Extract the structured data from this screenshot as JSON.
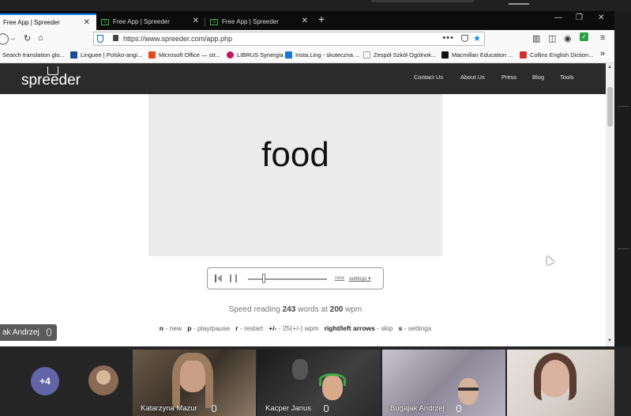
{
  "browser": {
    "tabs": [
      {
        "label": "Free App | Spreeder",
        "active": true
      },
      {
        "label": "Free App | Spreeder",
        "active": false
      },
      {
        "label": "Free App | Spreeder",
        "active": false
      }
    ],
    "new_tab": "+",
    "window_controls": {
      "minimize": "—",
      "restore": "❐",
      "close": "✕"
    },
    "url": "https://www.spreeder.com/app.php",
    "url_menu": "•••",
    "bookmarks": [
      {
        "label": "Search translation glo...",
        "color": "#8a8a8a"
      },
      {
        "label": "Linguee | Polsko-angi...",
        "color": "#1b4c8c"
      },
      {
        "label": "Microsoft Office — str...",
        "color": "#e64a19"
      },
      {
        "label": "LIBRUS Synergia",
        "color": "#c2185b"
      },
      {
        "label": "Insta.Ling - skuteczna ...",
        "color": "#1976d2"
      },
      {
        "label": "Zespół Szkół Ogólnok...",
        "color": "#9e9e9e"
      },
      {
        "label": "Macmillan Education ...",
        "color": "#111111"
      },
      {
        "label": "Collins English Diction...",
        "color": "#d32f2f"
      }
    ],
    "bookmarks_overflow": "»"
  },
  "site": {
    "logo": "spreeder",
    "nav": [
      "Contact Us",
      "About Us",
      "Press",
      "Blog",
      "Tools"
    ]
  },
  "reader": {
    "word": "food",
    "new_label": "new",
    "settings_label": "settings ▾",
    "speed_slider_fraction": 0.2,
    "speed_prefix": "Speed reading",
    "word_count": "243",
    "speed_middle": "words at",
    "wpm_value": "200",
    "speed_suffix": "wpm"
  },
  "shortcuts": [
    {
      "key": "n",
      "desc": " - new"
    },
    {
      "key": "p",
      "desc": " - play/pause"
    },
    {
      "key": "r",
      "desc": " - restart"
    },
    {
      "key": "+/-",
      "desc": " - 25(+/-) wpm"
    },
    {
      "key": "right/left arrows",
      "desc": " - skip"
    },
    {
      "key": "s",
      "desc": " - settings"
    }
  ],
  "call": {
    "active_speaker": "ak Andrzej",
    "more_participants": "+4",
    "participants": [
      {
        "name": "Katarzyna Mazur"
      },
      {
        "name": "Kacper Janus"
      },
      {
        "name": "Bugajak Andrzej"
      },
      {
        "name": ""
      }
    ]
  }
}
